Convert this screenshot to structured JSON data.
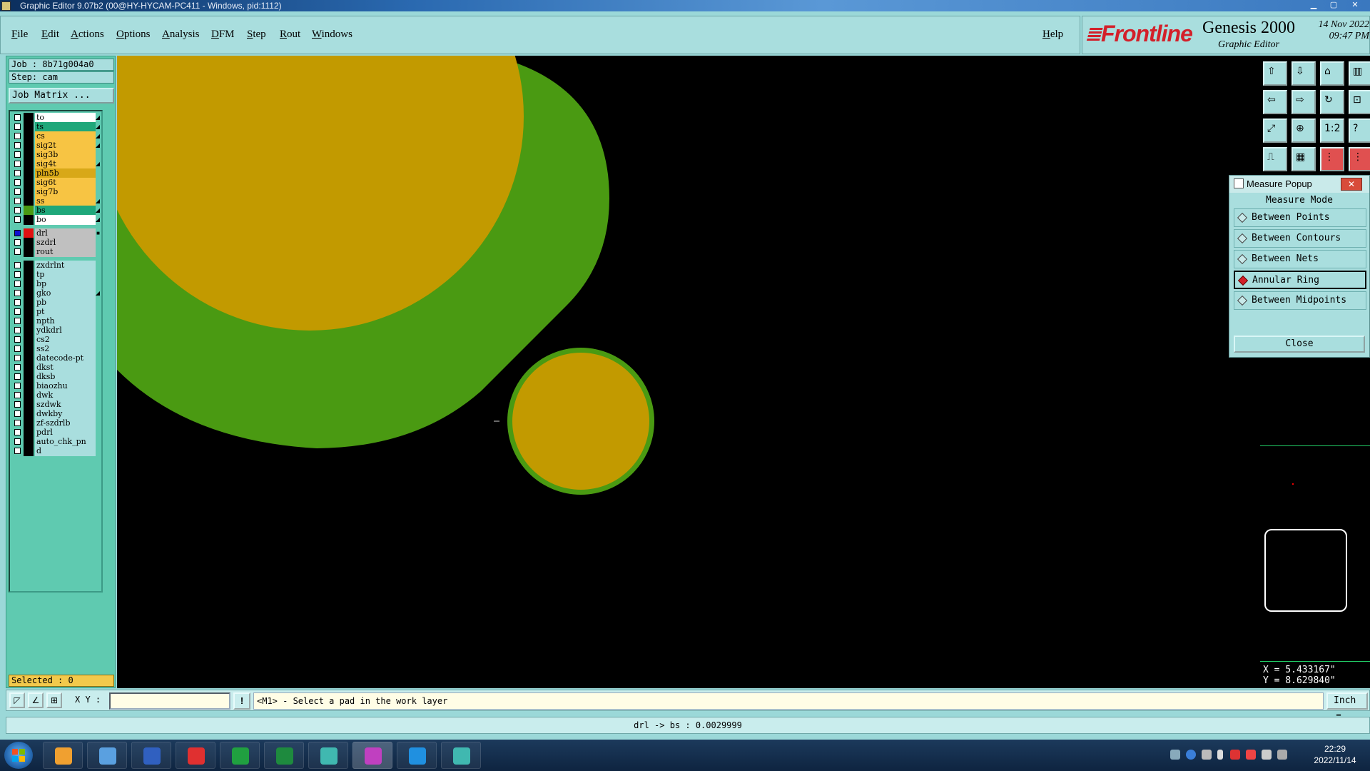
{
  "window": {
    "title": "Graphic Editor 9.07b2 (00@HY-HYCAM-PC411 - Windows, pid:1112)"
  },
  "menu": {
    "items": [
      "File",
      "Edit",
      "Actions",
      "Options",
      "Analysis",
      "DFM",
      "Step",
      "Rout",
      "Windows"
    ],
    "help": "Help"
  },
  "logo": {
    "brand": "Frontline",
    "product": "Genesis 2000",
    "subtitle": "Graphic Editor",
    "date": "14 Nov 2022",
    "time": "09:47 PM"
  },
  "job": {
    "job_label": "Job : 8b71g004a0",
    "step_label": "Step: cam",
    "matrix_button": "Job Matrix ..."
  },
  "layers": [
    {
      "name": "to",
      "color": "#ffffff",
      "arrow": true
    },
    {
      "name": "ts",
      "color": "#1fa77a",
      "arrow": true
    },
    {
      "name": "cs",
      "color": "#f7c443",
      "arrow": true
    },
    {
      "name": "sig2t",
      "color": "#f7c443",
      "arrow": true
    },
    {
      "name": "sig3b",
      "color": "#f7c443",
      "arrow": false
    },
    {
      "name": "sig4t",
      "color": "#f7c443",
      "arrow": true
    },
    {
      "name": "pln5b",
      "color": "#d8a818",
      "arrow": false
    },
    {
      "name": "sig6t",
      "color": "#f7c443",
      "arrow": false
    },
    {
      "name": "sig7b",
      "color": "#f7c443",
      "arrow": false
    },
    {
      "name": "ss",
      "color": "#f7c443",
      "arrow": true
    },
    {
      "name": "bs",
      "color": "#1fa77a",
      "arrow": true,
      "swatch": "#4a9a12"
    },
    {
      "name": "bo",
      "color": "#ffffff",
      "arrow": true
    },
    {
      "name": "drl",
      "color": "#c0c0c0",
      "arrow": false,
      "swatch": "#e01010",
      "selected": true,
      "marker": "■"
    },
    {
      "name": "szdrl",
      "color": "#c0c0c0",
      "arrow": false
    },
    {
      "name": "rout",
      "color": "#c0c0c0",
      "arrow": false
    },
    {
      "name": "zxdrlnt",
      "color": "#a9dede",
      "arrow": false
    },
    {
      "name": "tp",
      "color": "#a9dede",
      "arrow": false
    },
    {
      "name": "bp",
      "color": "#a9dede",
      "arrow": false
    },
    {
      "name": "gko",
      "color": "#a9dede",
      "arrow": true
    },
    {
      "name": "pb",
      "color": "#a9dede",
      "arrow": false
    },
    {
      "name": "pt",
      "color": "#a9dede",
      "arrow": false
    },
    {
      "name": "npth",
      "color": "#a9dede",
      "arrow": false
    },
    {
      "name": "ydkdrl",
      "color": "#a9dede",
      "arrow": false
    },
    {
      "name": "cs2",
      "color": "#a9dede",
      "arrow": false
    },
    {
      "name": "ss2",
      "color": "#a9dede",
      "arrow": false
    },
    {
      "name": "datecode-pt",
      "color": "#a9dede",
      "arrow": false
    },
    {
      "name": "dkst",
      "color": "#a9dede",
      "arrow": false
    },
    {
      "name": "dksb",
      "color": "#a9dede",
      "arrow": false
    },
    {
      "name": "biaozhu",
      "color": "#a9dede",
      "arrow": false
    },
    {
      "name": "dwk",
      "color": "#a9dede",
      "arrow": false
    },
    {
      "name": "szdwk",
      "color": "#a9dede",
      "arrow": false
    },
    {
      "name": "dwkby",
      "color": "#a9dede",
      "arrow": false
    },
    {
      "name": "zf-szdrlb",
      "color": "#a9dede",
      "arrow": false
    },
    {
      "name": "pdrl",
      "color": "#a9dede",
      "arrow": false
    },
    {
      "name": "auto_chk_pn",
      "color": "#a9dede",
      "arrow": false
    },
    {
      "name": "d",
      "color": "#a9dede",
      "arrow": false
    }
  ],
  "selected": "Selected : 0",
  "toolbar_icons": [
    "zoom-home-icon",
    "zoom-out-icon",
    "home-icon",
    "panel-icon",
    "zoom-in-icon",
    "pan-icon",
    "flip-icon",
    "snap-icon",
    "fit-icon",
    "center-icon",
    "scale-icon",
    "help-icon",
    "measure-icon",
    "grid-icon",
    "layer-compare-icon",
    "layer-compare-2-icon"
  ],
  "toolbar_glyphs": [
    "⇧",
    "⇩",
    "⌂",
    "▥",
    "⇦",
    "⇨",
    "↻",
    "⊡",
    "⤢",
    "⊕",
    "1:2",
    "?",
    "⎍",
    "▦",
    "⋮",
    "⋮"
  ],
  "measure_popup": {
    "title": "Measure Popup",
    "close_x": "✕",
    "header": "Measure Mode",
    "options": [
      {
        "label": "Between Points",
        "selected": false
      },
      {
        "label": "Between Contours",
        "selected": false
      },
      {
        "label": "Between Nets",
        "selected": false
      },
      {
        "label": "Annular Ring",
        "selected": true
      },
      {
        "label": "Between Midpoints",
        "selected": false
      }
    ],
    "close_button": "Close"
  },
  "coords": {
    "x": "X = 5.433167\"",
    "y": "Y = 8.629840\""
  },
  "bottom": {
    "xy_label": "X Y :",
    "xy_value": "",
    "bang": "!",
    "prompt": "<M1> - Select a pad in the work layer",
    "units": "Inch"
  },
  "status": "drl -> bs : 0.0029999",
  "canvas_colors": {
    "background": "#000000",
    "bs_layer": "#4a9a12",
    "copper": "#c29a00",
    "selection_highlight": "#d3202a"
  },
  "taskbar": {
    "apps": [
      "explorer-shell-icon",
      "notepad-icon",
      "save-disk-icon",
      "red-swirl-app-icon",
      "green-p-app-icon",
      "excel-icon",
      "genesis-eye-icon",
      "x-app-icon",
      "arrow-app-icon",
      "genesis-eye-2-icon"
    ],
    "app_colors": [
      "#f0a030",
      "#5aa0e0",
      "#3060c0",
      "#e03030",
      "#20a040",
      "#1e8a3e",
      "#40b8b0",
      "#c040c0",
      "#2090e0",
      "#40b8b0"
    ],
    "active_index": 7,
    "time": "22:29",
    "date": "2022/11/14"
  }
}
